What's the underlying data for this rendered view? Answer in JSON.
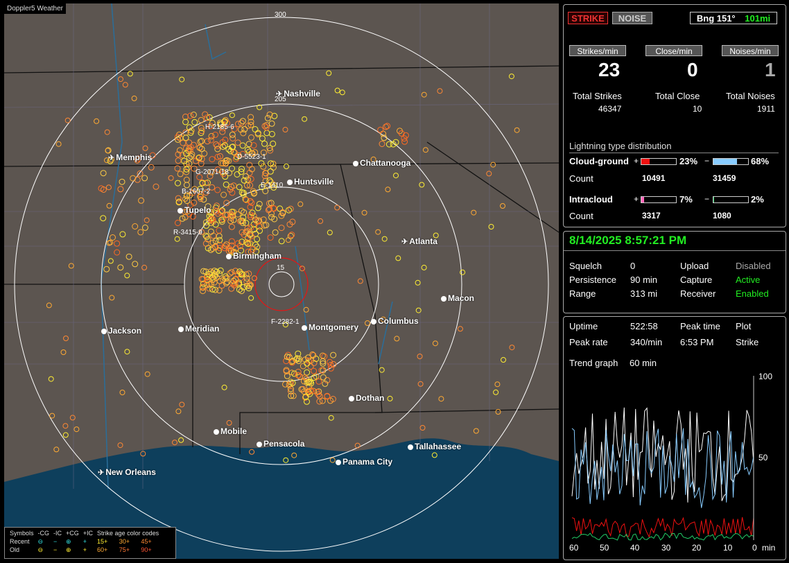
{
  "map": {
    "title": "Doppler5 Weather",
    "ring_labels": [
      "300",
      "205",
      "15"
    ],
    "cities": [
      {
        "name": "Nashville",
        "icon": "plane-icon"
      },
      {
        "name": "Memphis",
        "icon": "plane-icon"
      },
      {
        "name": "Chattanooga",
        "icon": "city-dot"
      },
      {
        "name": "Huntsville",
        "icon": "city-dot"
      },
      {
        "name": "Tupelo",
        "icon": "city-dot"
      },
      {
        "name": "Atlanta",
        "icon": "plane-icon"
      },
      {
        "name": "Birmingham",
        "icon": "city-dot"
      },
      {
        "name": "Macon",
        "icon": "city-dot"
      },
      {
        "name": "Jackson",
        "icon": "city-dot"
      },
      {
        "name": "Meridian",
        "icon": "city-dot"
      },
      {
        "name": "Montgomery",
        "icon": "city-dot"
      },
      {
        "name": "Columbus",
        "icon": "city-dot"
      },
      {
        "name": "Dothan",
        "icon": "city-dot"
      },
      {
        "name": "Mobile",
        "icon": "city-dot"
      },
      {
        "name": "Pensacola",
        "icon": "city-dot"
      },
      {
        "name": "Tallahassee",
        "icon": "city-dot"
      },
      {
        "name": "Panama City",
        "icon": "city-dot"
      },
      {
        "name": "New Orleans",
        "icon": "plane-icon"
      }
    ],
    "flags": [
      "H-2185-6",
      "D-5523-1",
      "G-2071-18",
      "E-1410",
      "B-1607-2",
      "R-3415-9",
      "F-2282-1"
    ],
    "legend": {
      "row_header": [
        "Symbols",
        "-CG",
        "-IC",
        "+CG",
        "+IC",
        "Strike age color codes"
      ],
      "recent": {
        "label": "Recent",
        "ages": [
          "15+",
          "30+",
          "45+"
        ]
      },
      "old": {
        "label": "Old",
        "ages": [
          "60+",
          "75+",
          "90+"
        ]
      }
    }
  },
  "status": {
    "strike_label": "STRIKE",
    "noise_label": "NOISE",
    "bearing": "Bng 151°",
    "distance": "101mi",
    "rate_buttons": [
      "Strikes/min",
      "Close/min",
      "Noises/min"
    ],
    "rates": [
      "23",
      "0",
      "1"
    ],
    "total_labels": [
      "Total Strikes",
      "Total Close",
      "Total Noises"
    ],
    "totals": [
      "46347",
      "10",
      "1911"
    ],
    "distribution_title": "Lightning type distribution",
    "cloud_ground": {
      "label": "Cloud-ground",
      "pos_sign": "+",
      "pos_pct": "23%",
      "pos_value": 0.23,
      "neg_sign": "−",
      "neg_pct": "68%",
      "neg_value": 0.68,
      "count_label": "Count",
      "pos_count": "10491",
      "neg_count": "31459"
    },
    "intracloud": {
      "label": "Intracloud",
      "pos_sign": "+",
      "pos_pct": "7%",
      "pos_value": 0.07,
      "neg_sign": "−",
      "neg_pct": "2%",
      "neg_value": 0.02,
      "count_label": "Count",
      "pos_count": "3317",
      "neg_count": "1080"
    }
  },
  "settings": {
    "datetime": "8/14/2025 8:57:21 PM",
    "rows": [
      [
        "Squelch",
        "0",
        "Upload",
        "Disabled"
      ],
      [
        "Persistence",
        "90 min",
        "Capture",
        "Active"
      ],
      [
        "Range",
        "313 mi",
        "Receiver",
        "Enabled"
      ]
    ]
  },
  "trend": {
    "rows": [
      [
        "Uptime",
        "522:58",
        "Peak time",
        "Plot"
      ],
      [
        "Peak rate",
        "340/min",
        "6:53 PM",
        "Strike"
      ]
    ],
    "trend_label": "Trend graph",
    "trend_value": "60 min",
    "y_ticks": [
      "100",
      "50"
    ],
    "x_ticks": [
      "60",
      "50",
      "40",
      "30",
      "20",
      "10",
      "0"
    ],
    "x_unit": "min"
  },
  "colors": {
    "accent_green": "#22ee22",
    "strike_red": "#ee1111",
    "bar_red": "#ee1111",
    "bar_blue": "#88ccff",
    "bar_pink": "#ff66bb",
    "bar_green": "#22cc66"
  }
}
